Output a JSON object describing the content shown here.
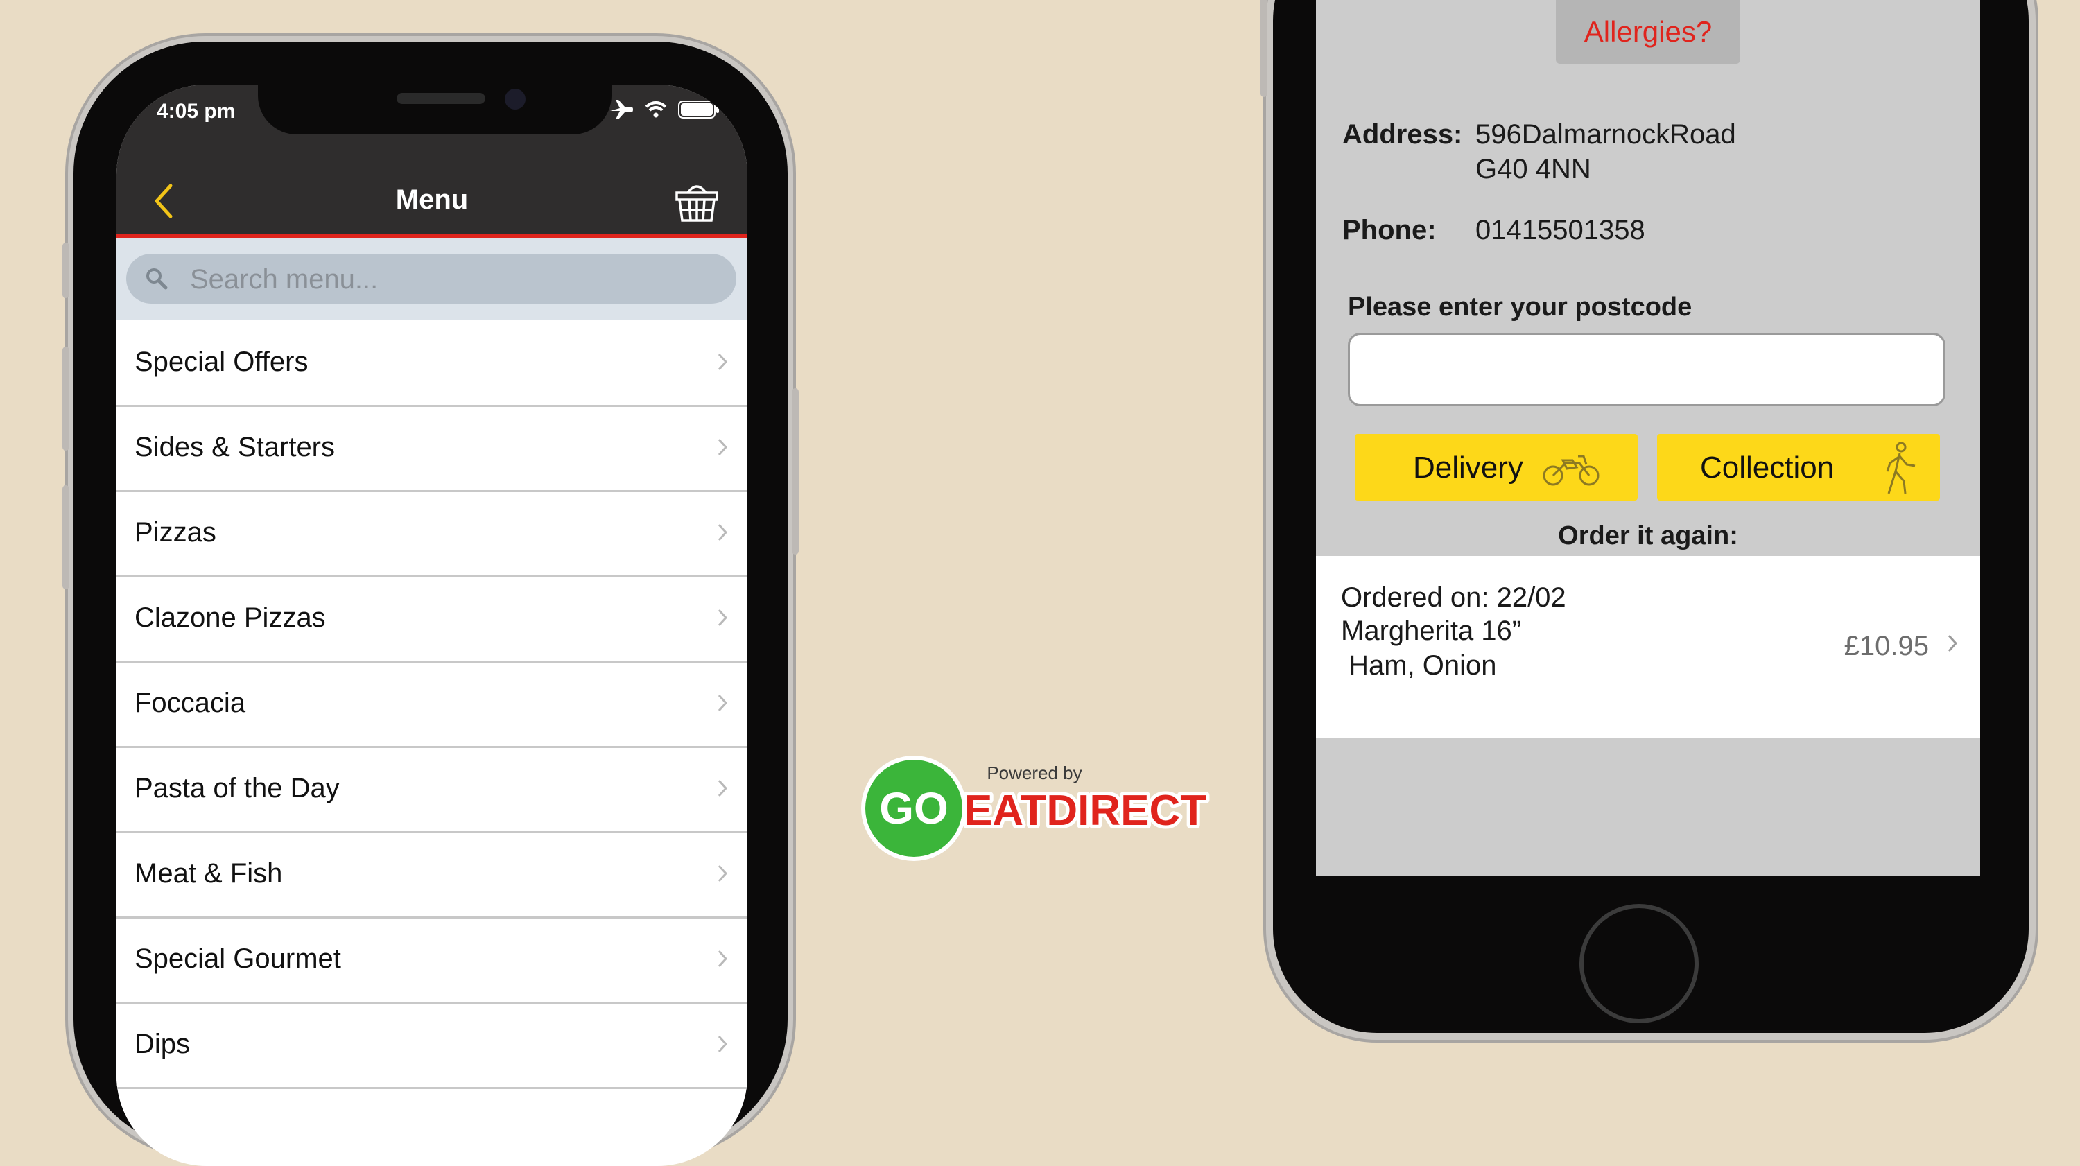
{
  "left_phone": {
    "status": {
      "time": "4:05 pm"
    },
    "nav": {
      "title": "Menu"
    },
    "search": {
      "placeholder": "Search menu..."
    },
    "menu_items": [
      "Special Offers",
      "Sides & Starters",
      "Pizzas",
      "Clazone Pizzas",
      "Foccacia",
      "Pasta of the Day",
      "Meat & Fish",
      "Special Gourmet",
      "Dips"
    ]
  },
  "logo": {
    "powered_by": "Powered by",
    "go": "GO",
    "brand": "EATDIRECT"
  },
  "right_phone": {
    "allergies": "Allergies?",
    "address_label": "Address:",
    "address_line1": "596DalmarnockRoad",
    "address_line2": "G40 4NN",
    "phone_label": "Phone:",
    "phone_value": "01415501358",
    "postcode_label": "Please enter your postcode",
    "postcode_value": "",
    "delivery_label": "Delivery",
    "collection_label": "Collection",
    "order_again_label": "Order it again:",
    "last_order": {
      "date_line": "Ordered on: 22/02",
      "item": "Margherita 16”",
      "toppings": " Ham, Onion",
      "price": "£10.95"
    }
  },
  "colors": {
    "background": "#e9dcc5",
    "nav_dark": "#2f2d2d",
    "accent_red": "#e0241d",
    "back_arrow": "#f2c418",
    "button_yellow": "#fdd819",
    "logo_green": "#3bb53a"
  }
}
